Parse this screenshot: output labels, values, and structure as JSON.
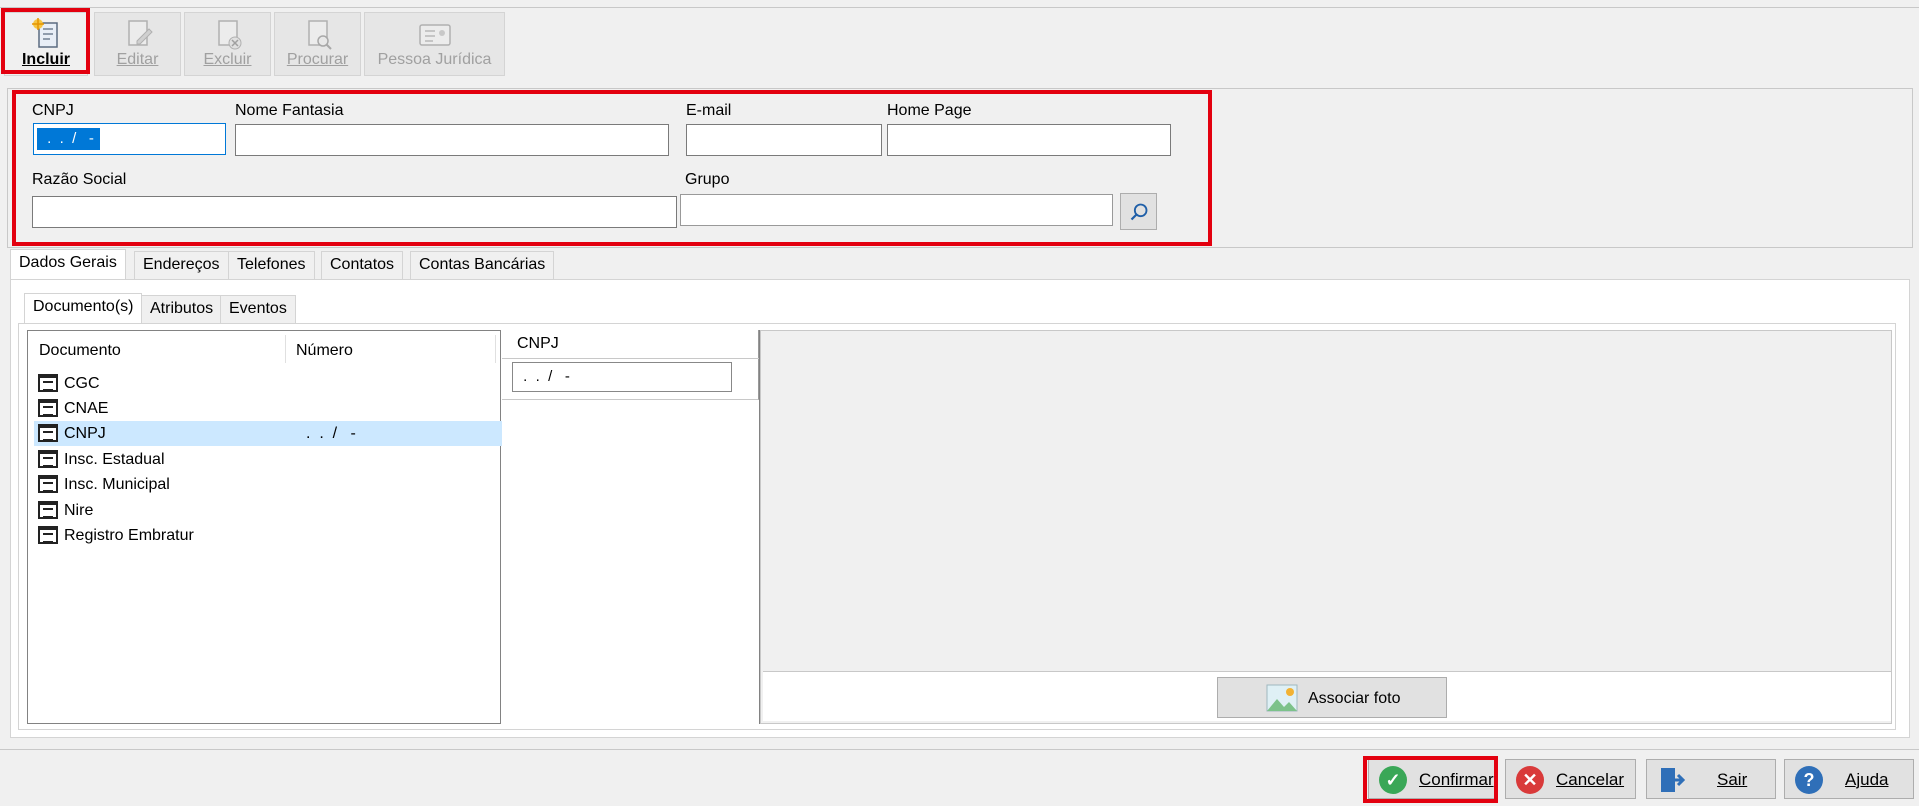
{
  "toolbar": {
    "incluir": "Incluir",
    "editar": "Editar",
    "excluir": "Excluir",
    "procurar": "Procurar",
    "pessoa_juridica": "Pessoa Jurídica"
  },
  "form": {
    "cnpj_label": "CNPJ",
    "cnpj_value": " .  .  /   -",
    "nome_fantasia_label": "Nome Fantasia",
    "nome_fantasia_value": "",
    "email_label": "E-mail",
    "email_value": "",
    "home_page_label": "Home Page",
    "home_page_value": "",
    "razao_social_label": "Razão Social",
    "razao_social_value": "",
    "grupo_label": "Grupo",
    "grupo_value": ""
  },
  "main_tabs": [
    "Dados Gerais",
    "Endereços",
    "Telefones",
    "Contatos",
    "Contas Bancárias"
  ],
  "sub_tabs": [
    "Documento(s)",
    "Atributos",
    "Eventos"
  ],
  "documents": {
    "columns": [
      "Documento",
      "Número"
    ],
    "rows": [
      {
        "name": "CGC",
        "number": ""
      },
      {
        "name": "CNAE",
        "number": ""
      },
      {
        "name": "CNPJ",
        "number": ".  .  /   -"
      },
      {
        "name": "Insc. Estadual",
        "number": ""
      },
      {
        "name": "Insc. Municipal",
        "number": ""
      },
      {
        "name": "Nire",
        "number": ""
      },
      {
        "name": "Registro Embratur",
        "number": ""
      }
    ]
  },
  "detail": {
    "label": "CNPJ",
    "value": " .  .  /   -"
  },
  "photo": {
    "button_label": "Associar foto"
  },
  "footer": {
    "confirmar": "Confirmar",
    "cancelar": "Cancelar",
    "sair": "Sair",
    "ajuda": "Ajuda"
  },
  "colors": {
    "highlight": "#e3000f",
    "selection": "#cce8ff",
    "input_focus": "#0078d7"
  }
}
